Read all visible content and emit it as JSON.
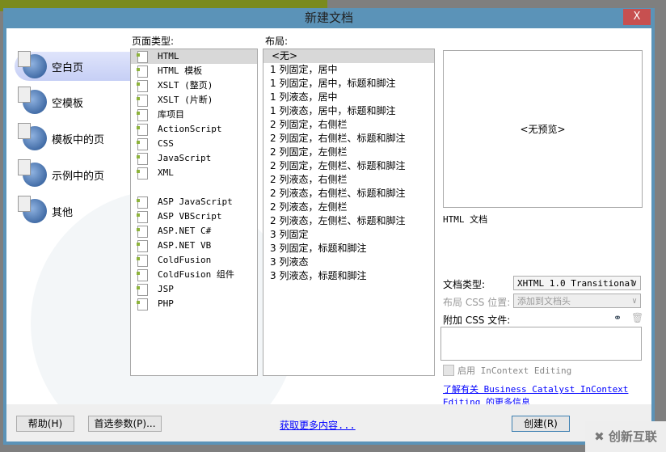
{
  "dialog": {
    "title": "新建文档",
    "close": "X"
  },
  "categories": [
    {
      "label": "空白页",
      "selected": true
    },
    {
      "label": "空模板"
    },
    {
      "label": "模板中的页"
    },
    {
      "label": "示例中的页"
    },
    {
      "label": "其他"
    }
  ],
  "page_type": {
    "header": "页面类型:",
    "items": [
      "HTML",
      "HTML 模板",
      "XSLT (整页)",
      "XSLT (片断)",
      "库项目",
      "ActionScript",
      "CSS",
      "JavaScript",
      "XML",
      "",
      "ASP JavaScript",
      "ASP VBScript",
      "ASP.NET C#",
      "ASP.NET VB",
      "ColdFusion",
      "ColdFusion 组件",
      "JSP",
      "PHP"
    ]
  },
  "layout": {
    "header": "布局:",
    "items": [
      "<无>",
      "1 列固定，居中",
      "1 列固定，居中，标题和脚注",
      "1 列液态，居中",
      "1 列液态，居中，标题和脚注",
      "2 列固定，右侧栏",
      "2 列固定，右侧栏、标题和脚注",
      "2 列固定，左侧栏",
      "2 列固定，左侧栏、标题和脚注",
      "2 列液态，右侧栏",
      "2 列液态，右侧栏、标题和脚注",
      "2 列液态，左侧栏",
      "2 列液态，左侧栏、标题和脚注",
      "3 列固定",
      "3 列固定，标题和脚注",
      "3 列液态",
      "3 列液态，标题和脚注"
    ]
  },
  "preview": {
    "text": "<无预览>",
    "caption": "HTML 文档"
  },
  "doc_type": {
    "label": "文档类型:",
    "value": "XHTML 1.0 Transitional"
  },
  "css_position": {
    "label": "布局 CSS 位置:",
    "value": "添加到文档头"
  },
  "attach_css": {
    "label": "附加 CSS 文件:"
  },
  "incontext": {
    "label": "启用 InContext Editing",
    "checked": false
  },
  "bc_link": {
    "line1": "了解有关 Business Catalyst InContext",
    "line2": "Editing 的更多信息"
  },
  "footer": {
    "help": "帮助(H)",
    "prefs": "首选参数(P)...",
    "more": "获取更多内容...",
    "create": "创建(R)"
  },
  "watermark": "创新互联"
}
